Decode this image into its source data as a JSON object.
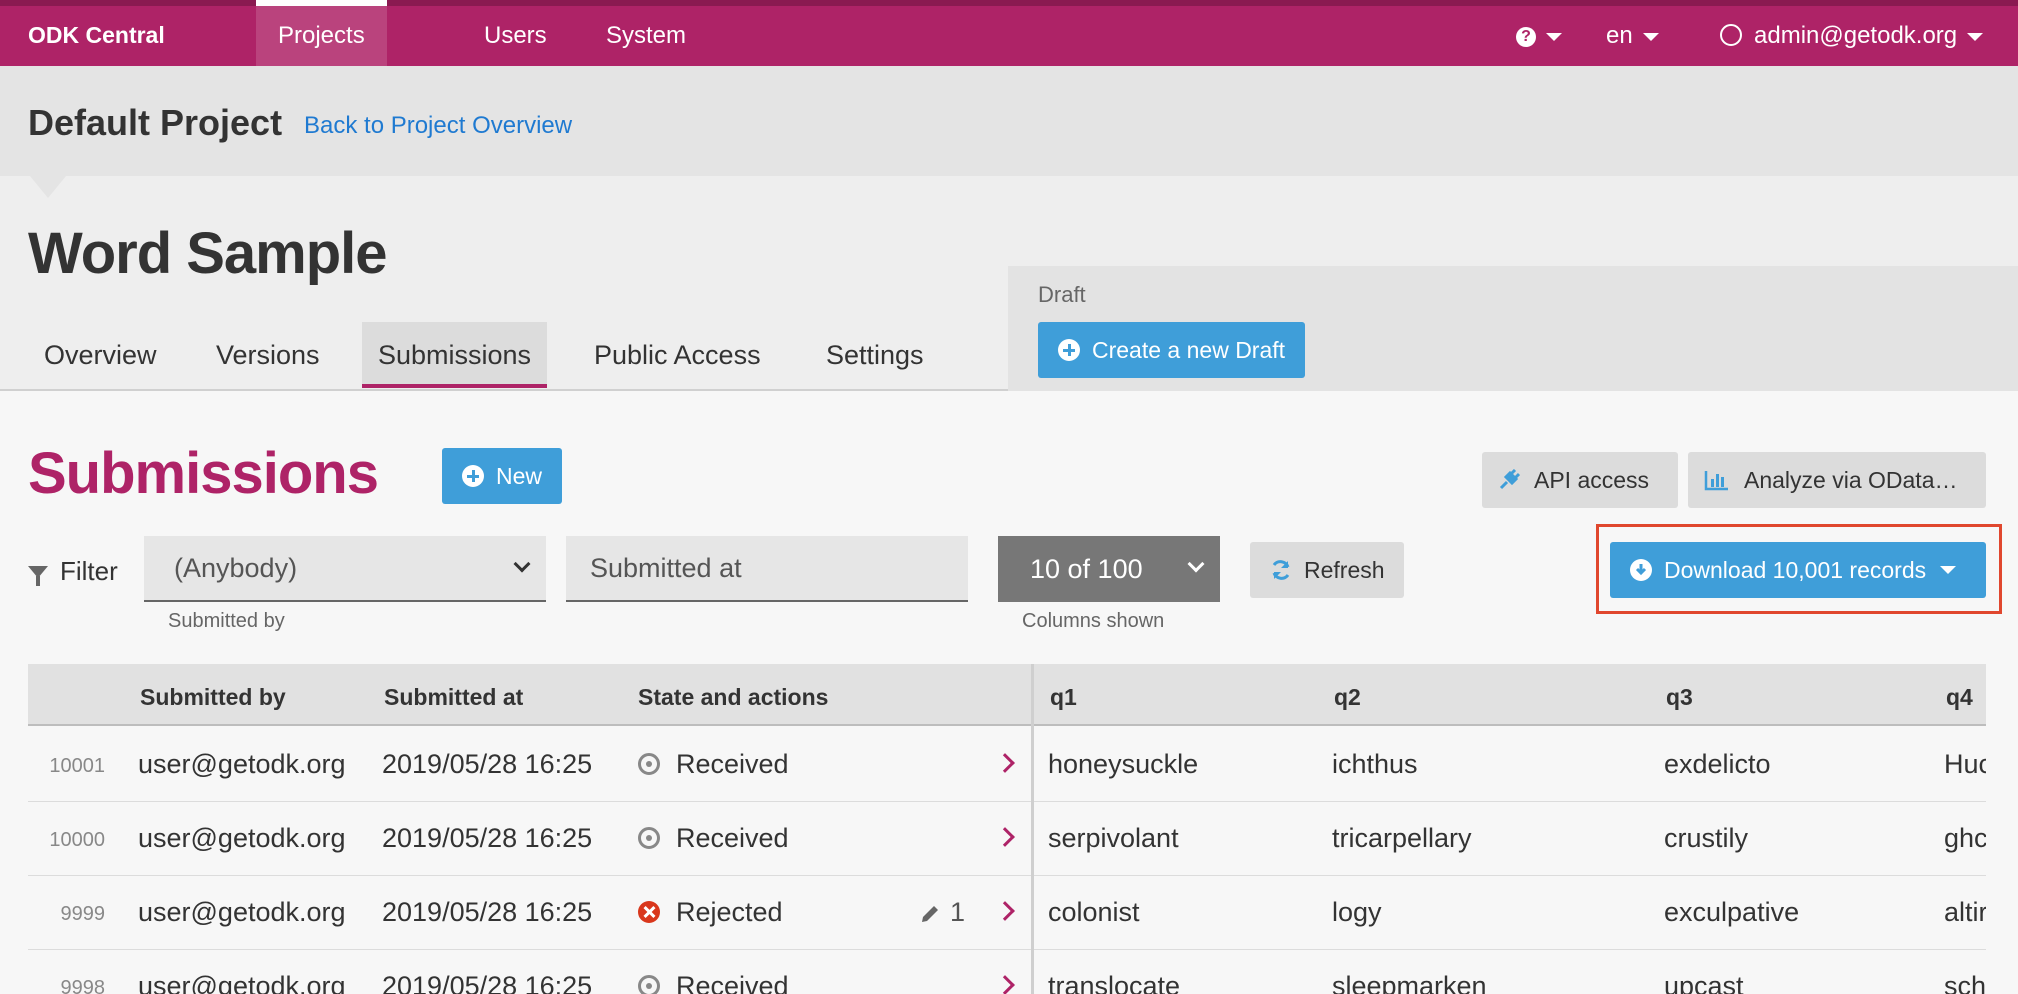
{
  "nav": {
    "brand": "ODK Central",
    "items": [
      {
        "label": "Projects"
      },
      {
        "label": "Users"
      },
      {
        "label": "System"
      }
    ],
    "language": "en",
    "user": "admin@getodk.org"
  },
  "project": {
    "title": "Default Project",
    "back_link": "Back to Project Overview"
  },
  "form": {
    "title": "Word Sample",
    "tabs": [
      {
        "label": "Overview"
      },
      {
        "label": "Versions"
      },
      {
        "label": "Submissions"
      },
      {
        "label": "Public Access"
      },
      {
        "label": "Settings"
      }
    ],
    "draft_label": "Draft",
    "create_draft_button": "Create a new Draft"
  },
  "submissions": {
    "title": "Submissions",
    "new_button": "New",
    "api_button": "API access",
    "odata_button": "Analyze via OData…",
    "filter_label": "Filter",
    "submitted_by_value": "(Anybody)",
    "submitted_by_help": "Submitted by",
    "submitted_at_placeholder": "Submitted at",
    "columns_value": "10 of 100",
    "columns_help": "Columns shown",
    "refresh_button": "Refresh",
    "download_button": "Download 10,001 records"
  },
  "table": {
    "headers": {
      "submitted_by": "Submitted by",
      "submitted_at": "Submitted at",
      "state": "State and actions",
      "q1": "q1",
      "q2": "q2",
      "q3": "q3",
      "q4": "q4"
    },
    "rows": [
      {
        "num": "10001",
        "by": "user@getodk.org",
        "at": "2019/05/28 16:25",
        "state": "Received",
        "edits": "",
        "q1": "honeysuckle",
        "q2": "ichthus",
        "q3": "exdelicto",
        "q4": "Huc"
      },
      {
        "num": "10000",
        "by": "user@getodk.org",
        "at": "2019/05/28 16:25",
        "state": "Received",
        "edits": "",
        "q1": "serpivolant",
        "q2": "tricarpellary",
        "q3": "crustily",
        "q4": "ghc"
      },
      {
        "num": "9999",
        "by": "user@getodk.org",
        "at": "2019/05/28 16:25",
        "state": "Rejected",
        "edits": "1",
        "q1": "colonist",
        "q2": "logy",
        "q3": "exculpative",
        "q4": "altir"
      },
      {
        "num": "9998",
        "by": "user@getodk.org",
        "at": "2019/05/28 16:25",
        "state": "Received",
        "edits": "",
        "q1": "translocate",
        "q2": "sleepmarken",
        "q3": "upcast",
        "q4": "sch"
      }
    ]
  },
  "colors": {
    "brand": "#ae2367",
    "accent_blue": "#3f9ed9",
    "link": "#1f7ad1",
    "highlight": "#e0472e"
  }
}
